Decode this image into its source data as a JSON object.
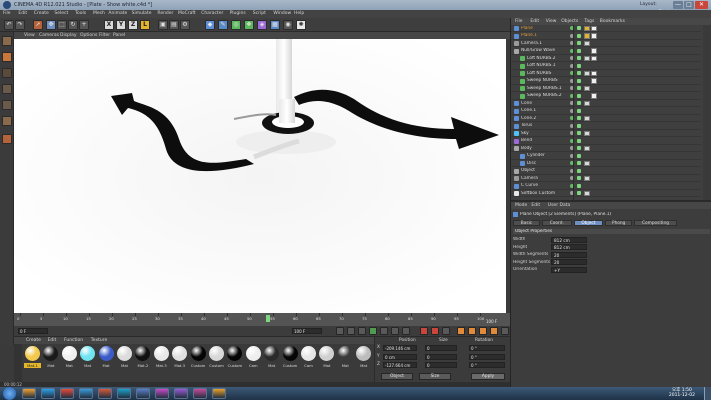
{
  "window": {
    "title": "CINEMA 4D R12.021 Studio - [Plate - Show white.c4d *]",
    "layout_label": "Layout:",
    "layout_value": "Startup",
    "controls": [
      "—",
      "□",
      "✕"
    ]
  },
  "menu": [
    "File",
    "Edit",
    "Create",
    "Select",
    "Tools",
    "Mesh",
    "Animate",
    "Simulate",
    "Render",
    "MoCraft",
    "Character",
    "Plugins",
    "Script",
    "Window",
    "Help"
  ],
  "toolbar": {
    "axis_labels": [
      "X",
      "Y",
      "Z",
      "L"
    ]
  },
  "viewport": {
    "menu": [
      "View",
      "Cameras",
      "Display",
      "Options",
      "Filter",
      "Panel"
    ]
  },
  "timeline": {
    "ticks": [
      "0",
      "5",
      "10",
      "15",
      "20",
      "25",
      "30",
      "35",
      "40",
      "45",
      "50",
      "55",
      "60",
      "65",
      "70",
      "75",
      "80",
      "85",
      "90",
      "95",
      "100"
    ],
    "current_frame": "0 F",
    "start_field": "0 F",
    "end_field": "100 F",
    "playhead_frame": 54,
    "last_frame": 100
  },
  "object_manager": {
    "menu": [
      "File",
      "Edit",
      "View",
      "Objects",
      "Tags",
      "Bookmarks"
    ],
    "rows": [
      {
        "name": "Plane",
        "color": "#e09b3b",
        "icon": "#5c8fd6",
        "indent": 0
      },
      {
        "name": "Plane.1",
        "color": "#e09b3b",
        "icon": "#5c8fd6",
        "indent": 0
      },
      {
        "name": "Camera.1",
        "color": "#dcdcdc",
        "icon": "#9a9a9a",
        "indent": 0
      },
      {
        "name": "Null/Grow Wave",
        "color": "#dcdcdc",
        "icon": "#a8a8a8",
        "indent": 0
      },
      {
        "name": "Loft NURBS.2",
        "color": "#dcdcdc",
        "icon": "#5cb85c",
        "indent": 6
      },
      {
        "name": "Loft NURBS.1",
        "color": "#dcdcdc",
        "icon": "#5cb85c",
        "indent": 6
      },
      {
        "name": "Loft NURBS",
        "color": "#dcdcdc",
        "icon": "#5cb85c",
        "indent": 6
      },
      {
        "name": "Sweep NURBS",
        "color": "#dcdcdc",
        "icon": "#5cb85c",
        "indent": 6
      },
      {
        "name": "Sweep NURBS.1",
        "color": "#dcdcdc",
        "icon": "#5cb85c",
        "indent": 6
      },
      {
        "name": "Sweep NURBS.2",
        "color": "#dcdcdc",
        "icon": "#5cb85c",
        "indent": 6
      },
      {
        "name": "Cone",
        "color": "#dcdcdc",
        "icon": "#5c8fd6",
        "indent": 0
      },
      {
        "name": "Cone.1",
        "color": "#dcdcdc",
        "icon": "#5c8fd6",
        "indent": 0
      },
      {
        "name": "Cone.2",
        "color": "#dcdcdc",
        "icon": "#5c8fd6",
        "indent": 0
      },
      {
        "name": "Torus",
        "color": "#dcdcdc",
        "icon": "#5c8fd6",
        "indent": 0
      },
      {
        "name": "Sky",
        "color": "#dcdcdc",
        "icon": "#4fc3f7",
        "indent": 0
      },
      {
        "name": "Bend",
        "color": "#dcdcdc",
        "icon": "#9c6ad6",
        "indent": 0
      },
      {
        "name": "Body",
        "color": "#dcdcdc",
        "icon": "#a8a8a8",
        "indent": 0
      },
      {
        "name": "Cylinder",
        "color": "#dcdcdc",
        "icon": "#5c8fd6",
        "indent": 6
      },
      {
        "name": "Disc",
        "color": "#dcdcdc",
        "icon": "#5c8fd6",
        "indent": 6
      },
      {
        "name": "Object",
        "color": "#dcdcdc",
        "icon": "#a8a8a8",
        "indent": 0
      },
      {
        "name": "Camera",
        "color": "#dcdcdc",
        "icon": "#9a9a9a",
        "indent": 0
      },
      {
        "name": "C Curve",
        "color": "#dcdcdc",
        "icon": "#5c8fd6",
        "indent": 0
      },
      {
        "name": "Softbox Custom",
        "color": "#dcdcdc",
        "icon": "#e8e8e8",
        "indent": 0
      }
    ]
  },
  "attribute_manager": {
    "menu": [
      "Mode",
      "Edit",
      "User Data"
    ],
    "object_title": "Plane Object [2 Elements] (Plane, Plane.1)",
    "tabs": [
      "Basic",
      "Coord.",
      "Object",
      "Phong",
      "Compositing"
    ],
    "active_tab": "Object",
    "section": "Object Properties",
    "fields": [
      {
        "label": "Width",
        "value": "812 cm"
      },
      {
        "label": "Height",
        "value": "812 cm"
      },
      {
        "label": "Width Segments",
        "value": "20"
      },
      {
        "label": "Height Segments",
        "value": "20"
      },
      {
        "label": "Orientation",
        "value": "+Y"
      }
    ]
  },
  "material_manager": {
    "menu": [
      "Create",
      "Edit",
      "Function",
      "Texture"
    ],
    "materials": [
      {
        "name": "Mat.1",
        "color": "#f2c94c",
        "selected": true
      },
      {
        "name": "Mat",
        "color": "#1a1a1a",
        "selected": false
      },
      {
        "name": "Mat",
        "color": "#f0f0f0",
        "selected": false
      },
      {
        "name": "Mat",
        "color": "#6fe3f0",
        "selected": false
      },
      {
        "name": "Mat",
        "color": "#3b5bc8",
        "selected": false
      },
      {
        "name": "Mat",
        "color": "#dcdcdc",
        "selected": false
      },
      {
        "name": "Mat.2",
        "color": "#101010",
        "selected": false
      },
      {
        "name": "Mat.3",
        "color": "#e8e8e8",
        "selected": false
      },
      {
        "name": "Mat.3",
        "color": "#e0e0e0",
        "selected": false
      },
      {
        "name": "Custom",
        "color": "#050505",
        "selected": false
      },
      {
        "name": "Custom",
        "color": "#d8d8d8",
        "selected": false
      },
      {
        "name": "Custom",
        "color": "#050505",
        "selected": false
      },
      {
        "name": "Cam",
        "color": "#eeeeee",
        "selected": false
      },
      {
        "name": "Mat",
        "color": "#2a2a2a",
        "selected": false
      },
      {
        "name": "Custom",
        "color": "#050505",
        "selected": false
      },
      {
        "name": "Cam",
        "color": "#e6e6e6",
        "selected": false
      },
      {
        "name": "Mat",
        "color": "#d0d0d0",
        "selected": false
      },
      {
        "name": "Mat",
        "color": "#3a3a3a",
        "selected": false
      },
      {
        "name": "Mat",
        "color": "#bdbdbd",
        "selected": false
      }
    ]
  },
  "coordinates": {
    "headers": [
      "Position",
      "Size",
      "Rotation"
    ],
    "rows": [
      {
        "axis": "X",
        "pos": "-209.146 cm",
        "size": "0",
        "rot": "0 °"
      },
      {
        "axis": "Y",
        "pos": "0 cm",
        "size": "0",
        "rot": "0 °"
      },
      {
        "axis": "Z",
        "pos": "-127.664 cm",
        "size": "0",
        "rot": "0 °"
      }
    ],
    "mode_object": "Object",
    "mode_size": "Size",
    "apply": "Apply"
  },
  "status": {
    "text": "00:00:12"
  },
  "taskbar": {
    "time": "오후 1:50",
    "date": "2011-12-02",
    "apps": [
      "#f0a030",
      "#2ea0e8",
      "#e84a3a",
      "#3a9ad9",
      "#d65a3a",
      "#1ca0c8",
      "#5a7fc8",
      "#c84ac8",
      "#9a5ad6",
      "#c84a9a",
      "#e8a02a"
    ]
  }
}
